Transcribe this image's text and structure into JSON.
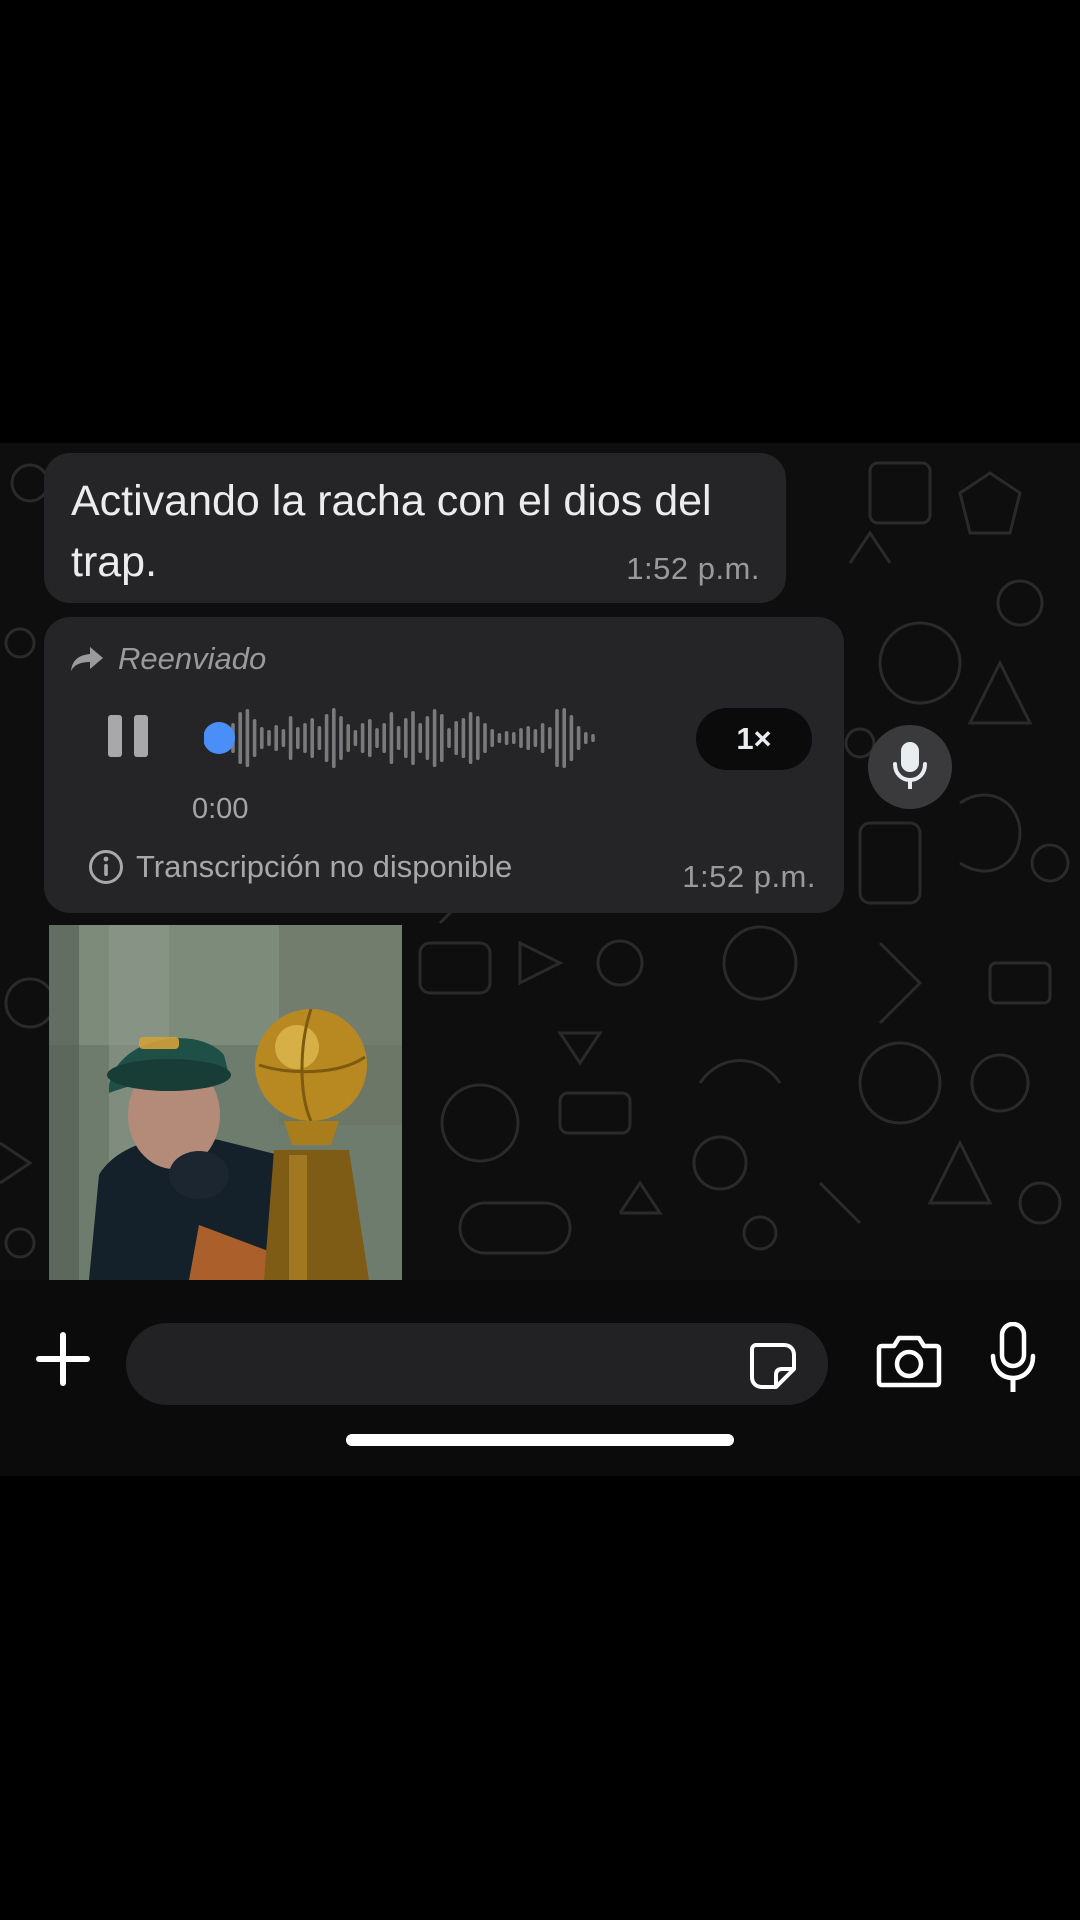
{
  "chat": {
    "messages": [
      {
        "type": "text",
        "text": "Activando la racha con el dios del trap.",
        "time": "1:52 p.m."
      },
      {
        "type": "voice",
        "forwarded_label": "Reenviado",
        "duration": "0:00",
        "speed": "1×",
        "playback_progress": 0.0,
        "state": "playing",
        "transcription_status": "Transcripción no disponible",
        "time": "1:52 p.m."
      },
      {
        "type": "image"
      }
    ]
  },
  "composer": {
    "placeholder": "",
    "icons": [
      "plus-icon",
      "sticker-icon",
      "camera-icon",
      "microphone-icon"
    ]
  },
  "colors": {
    "bubble": "#252527",
    "background": "#0e0e0e",
    "progress_dot": "#4a8ff7",
    "meta_text": "#9a9a9a"
  }
}
